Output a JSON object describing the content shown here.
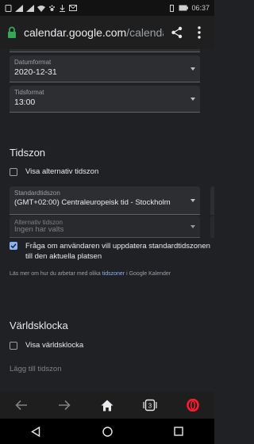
{
  "status_bar": {
    "time": "06:37",
    "battery": "▮"
  },
  "browser": {
    "url_host": "calendar.google.com",
    "url_path": "/calendar/r",
    "tab_count": "3"
  },
  "settings": {
    "date_format": {
      "label": "Datumformat",
      "value": "2020-12-31"
    },
    "time_format": {
      "label": "Tidsformat",
      "value": "13:00"
    },
    "timezone_section": {
      "title": "Tidszon",
      "show_alt_tz": "Visa alternativ tidszon",
      "primary_tz": {
        "label": "Standardtidszon",
        "value": "(GMT+02:00) Centraleuropeisk tid - Stockholm"
      },
      "alt_tz": {
        "label": "Alternativ tidszon",
        "value": "Ingen har valts"
      },
      "ask_update": "Fråga om användaren vill uppdatera standardtidszonen till den aktuella platsen",
      "info_prefix": "Läs mer om hur du arbetar med olika ",
      "info_link": "tidszoner",
      "info_suffix": " i Google Kalender"
    },
    "world_clock": {
      "title": "Världsklocka",
      "show_world_clock": "Visa världsklocka",
      "add_timezone": "Lägg till tidszon"
    }
  },
  "colors": {
    "accent": "#8ab4f8",
    "background": "#202124",
    "opera_red": "#ff1b2d"
  }
}
